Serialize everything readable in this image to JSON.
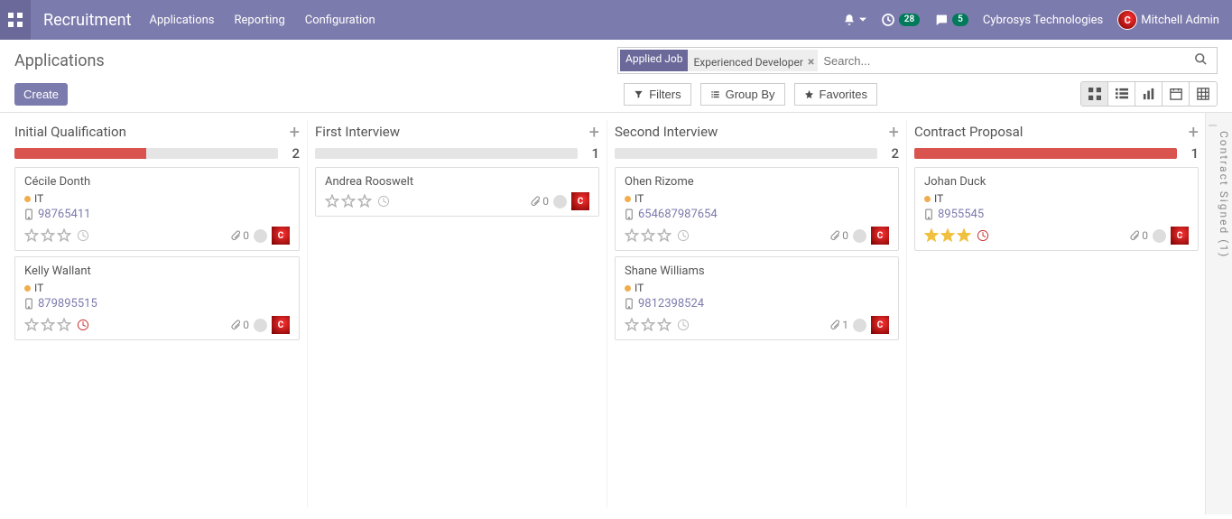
{
  "topbar": {
    "brand": "Recruitment",
    "menus": [
      "Applications",
      "Reporting",
      "Configuration"
    ],
    "activity_badge": "28",
    "discuss_badge": "5",
    "company": "Cybrosys Technologies",
    "user": "Mitchell Admin"
  },
  "control_panel": {
    "title": "Applications",
    "create_label": "Create",
    "search": {
      "facet_label": "Applied Job",
      "facet_value": "Experienced Developer",
      "placeholder": "Search..."
    },
    "filters": {
      "filters_label": "Filters",
      "groupby_label": "Group By",
      "favorites_label": "Favorites"
    }
  },
  "kanban": {
    "columns": [
      {
        "title": "Initial Qualification",
        "count": "2",
        "progress": [
          {
            "color": "#d9534f",
            "pct": 50
          }
        ],
        "cards": [
          {
            "name": "Cécile Donth",
            "tag": "IT",
            "tag_color": "#f0ad4e",
            "phone": "98765411",
            "stars": 0,
            "clock": "grey",
            "attach": "0",
            "avatar": true
          },
          {
            "name": "Kelly Wallant",
            "tag": "IT",
            "tag_color": "#f0ad4e",
            "phone": "879895515",
            "stars": 0,
            "clock": "red",
            "attach": "0",
            "avatar": true
          }
        ]
      },
      {
        "title": "First Interview",
        "count": "1",
        "progress": [],
        "cards": [
          {
            "name": "Andrea Rooswelt",
            "tag": null,
            "phone": null,
            "stars": 0,
            "clock": "grey",
            "attach": "0",
            "avatar": true
          }
        ]
      },
      {
        "title": "Second Interview",
        "count": "2",
        "progress": [],
        "cards": [
          {
            "name": "Ohen Rizome",
            "tag": "IT",
            "tag_color": "#f0ad4e",
            "phone": "654687987654",
            "stars": 0,
            "clock": "grey",
            "attach": "0",
            "avatar": true
          },
          {
            "name": "Shane Williams",
            "tag": "IT",
            "tag_color": "#f0ad4e",
            "phone": "9812398524",
            "stars": 0,
            "clock": "grey",
            "attach": "1",
            "avatar": true
          }
        ]
      },
      {
        "title": "Contract Proposal",
        "count": "1",
        "progress": [
          {
            "color": "#d9534f",
            "pct": 100
          }
        ],
        "cards": [
          {
            "name": "Johan Duck",
            "tag": "IT",
            "tag_color": "#f0ad4e",
            "phone": "8955545",
            "stars": 3,
            "clock": "red",
            "attach": "0",
            "avatar": true
          }
        ]
      }
    ],
    "collapsed": {
      "label": "Contract Signed (1)"
    }
  }
}
